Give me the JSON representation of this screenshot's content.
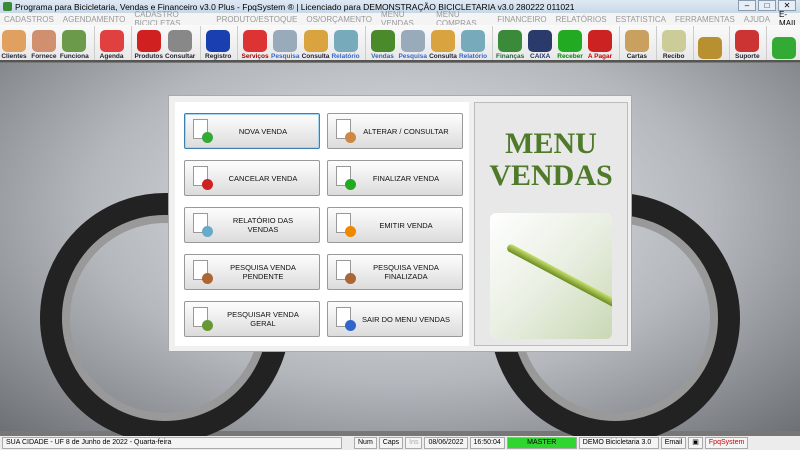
{
  "title": "Programa para Bicicletaria, Vendas e Financeiro v3.0 Plus - FpqSystem ® | Licenciado para  DEMONSTRAÇÃO BICICLETARIA v3.0 280222 011021",
  "menu": [
    "CADASTROS",
    "AGENDAMENTO",
    "CADASTRO BICICLETAS",
    "PRODUTO/ESTOQUE",
    "OS/ORÇAMENTO",
    "MENU VENDAS",
    "MENU COMPRAS",
    "FINANCEIRO",
    "RELATÓRIOS",
    "ESTATISTICA",
    "FERRAMENTAS",
    "AJUDA"
  ],
  "menu_email": "E-MAIL",
  "toolbar": [
    {
      "label": "Clientes",
      "icon": "clients-icon",
      "color": "#223",
      "ic": "#e0a060"
    },
    {
      "label": "Fornece",
      "icon": "supplier-icon",
      "color": "#223",
      "ic": "#d09070"
    },
    {
      "label": "Funciona",
      "icon": "employee-icon",
      "color": "#223",
      "ic": "#6a9a4a"
    },
    {
      "sep": true
    },
    {
      "label": "Agenda",
      "icon": "calendar-icon",
      "color": "#222",
      "ic": "#e04040"
    },
    {
      "sep": true
    },
    {
      "label": "Produtos",
      "icon": "toolbox-icon",
      "color": "#223",
      "ic": "#d02020"
    },
    {
      "label": "Consultar",
      "icon": "barcode-icon",
      "color": "#223",
      "ic": "#888"
    },
    {
      "sep": true
    },
    {
      "label": "Registro",
      "icon": "bicycle-icon",
      "color": "#223",
      "ic": "#1a3fb0"
    },
    {
      "sep": true
    },
    {
      "label": "Serviços",
      "icon": "bike-service-icon",
      "color": "#a00",
      "ic": "#d33"
    },
    {
      "label": "Pesquisa",
      "icon": "search-doc-icon",
      "color": "#36c",
      "ic": "#9ab"
    },
    {
      "label": "Consulta",
      "icon": "drawer-icon",
      "color": "#223",
      "ic": "#d9a440"
    },
    {
      "label": "Relatório",
      "icon": "printer-icon",
      "color": "#36c",
      "ic": "#7ab"
    },
    {
      "sep": true
    },
    {
      "label": "Vendas",
      "icon": "cart-icon",
      "color": "#36a",
      "ic": "#4a8a2a"
    },
    {
      "label": "Pesquisa",
      "icon": "search-doc-icon",
      "color": "#36c",
      "ic": "#9ab"
    },
    {
      "label": "Consulta",
      "icon": "drawer-icon",
      "color": "#223",
      "ic": "#d9a440"
    },
    {
      "label": "Relatório",
      "icon": "printer-icon",
      "color": "#36c",
      "ic": "#7ab"
    },
    {
      "sep": true
    },
    {
      "label": "Finanças",
      "icon": "finance-icon",
      "color": "#263",
      "ic": "#3a8a3a"
    },
    {
      "label": "CAIXA",
      "icon": "cashbook-icon",
      "color": "#236",
      "ic": "#2a3a6a"
    },
    {
      "label": "Receber",
      "icon": "receive-money-icon",
      "color": "#080",
      "ic": "#2a2"
    },
    {
      "label": "A Pagar",
      "icon": "pay-money-icon",
      "color": "#c00",
      "ic": "#c22"
    },
    {
      "sep": true
    },
    {
      "label": "Cartas",
      "icon": "scroll-icon",
      "color": "#222",
      "ic": "#c9a060"
    },
    {
      "sep": true
    },
    {
      "label": "Recibo",
      "icon": "receipt-icon",
      "color": "#222",
      "ic": "#cc9"
    },
    {
      "sep": true
    },
    {
      "label": "",
      "icon": "coin-icon",
      "color": "#222",
      "ic": "#b89030"
    },
    {
      "sep": true
    },
    {
      "label": "Suporte",
      "icon": "support-icon",
      "color": "#223",
      "ic": "#c33"
    },
    {
      "sep": true
    },
    {
      "label": "",
      "icon": "exit-icon",
      "color": "#222",
      "ic": "#3a3"
    }
  ],
  "buttons": [
    {
      "label": "NOVA VENDA",
      "icon": "new-document-icon",
      "selected": true
    },
    {
      "label": "ALTERAR / CONSULTAR",
      "icon": "edit-pencil-icon"
    },
    {
      "label": "CANCELAR VENDA",
      "icon": "cancel-document-icon"
    },
    {
      "label": "FINALIZAR VENDA",
      "icon": "check-document-icon"
    },
    {
      "label": "RELATÓRIO DAS VENDAS",
      "icon": "printer-icon"
    },
    {
      "label": "EMITIR VENDA",
      "icon": "emit-person-icon"
    },
    {
      "label": "PESQUISA VENDA PENDENTE",
      "icon": "search-pending-icon"
    },
    {
      "label": "PESQUISA VENDA FINALIZADA",
      "icon": "search-finished-icon"
    },
    {
      "label": "PESQUISAR VENDA GERAL",
      "icon": "search-general-icon"
    },
    {
      "label": "SAIR DO MENU VENDAS",
      "icon": "exit-document-icon"
    }
  ],
  "heading": {
    "line1": "MENU",
    "line2": "VENDAS"
  },
  "status": {
    "location": "SUA CIDADE - UF  8 de Junho de 2022 - Quarta-feira",
    "num": "Num",
    "caps": "Caps",
    "ins": "Ins",
    "date": "08/06/2022",
    "time": "16:50:04",
    "user": "MASTER",
    "version": "DEMO Bicicletaria 3.0",
    "email": "Email",
    "brand": "FpqSystem"
  }
}
